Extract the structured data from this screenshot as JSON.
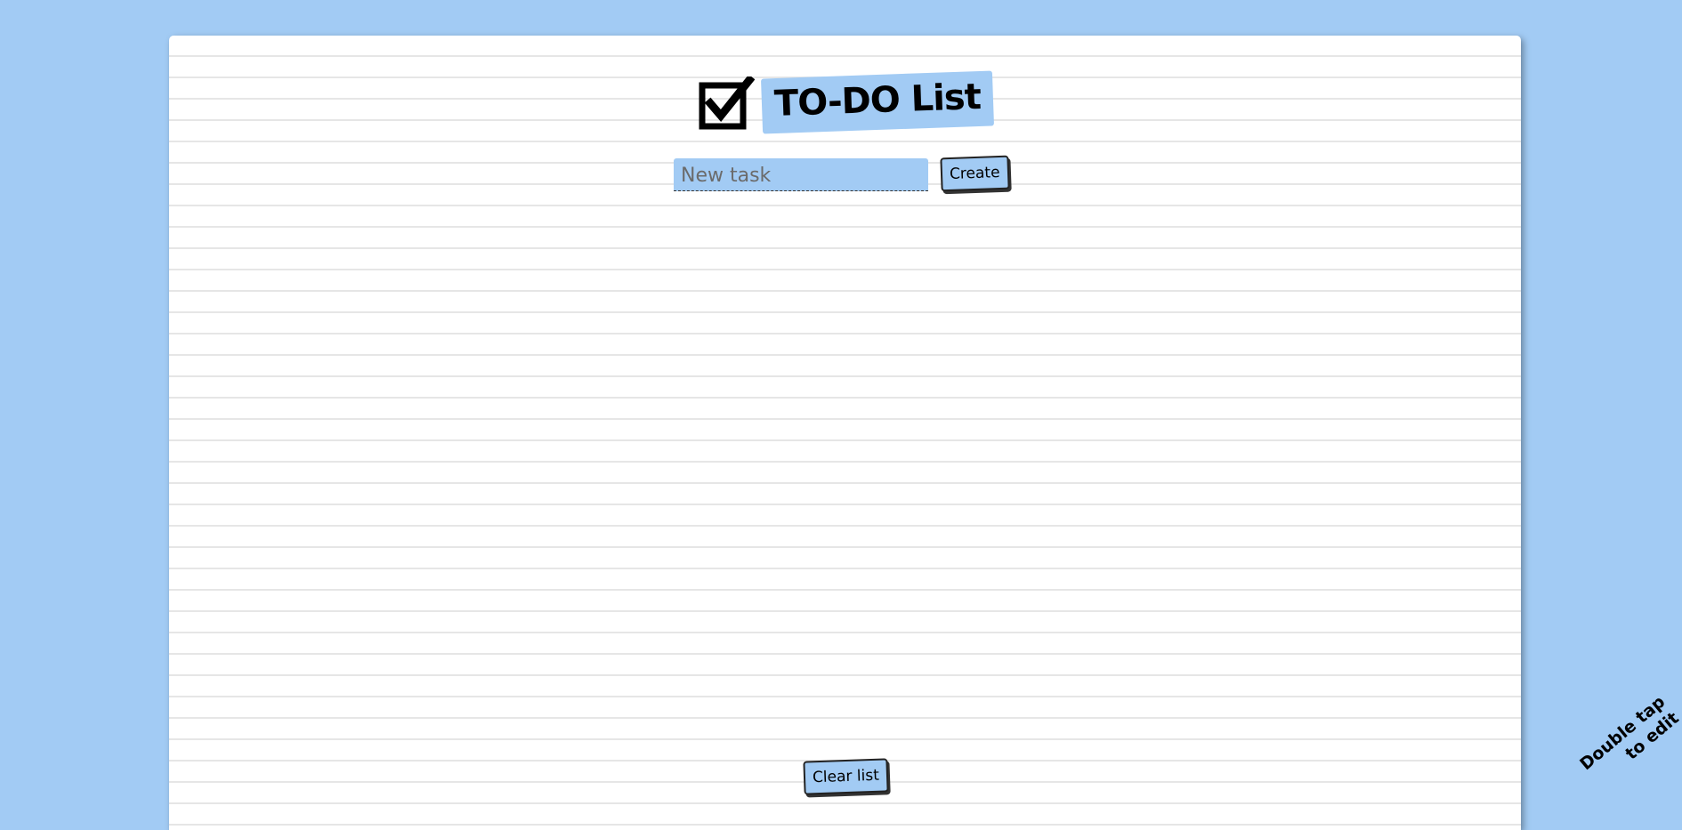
{
  "app": {
    "title": "TO-DO List",
    "accent_color": "#a2cbf4",
    "icon": "checkbox-checked-icon"
  },
  "form": {
    "input_placeholder": "New task",
    "input_value": "",
    "create_label": "Create"
  },
  "tasks": [],
  "footer": {
    "clear_label": "Clear list"
  },
  "hint": {
    "line1": "Double tap",
    "line2": "to edit"
  }
}
